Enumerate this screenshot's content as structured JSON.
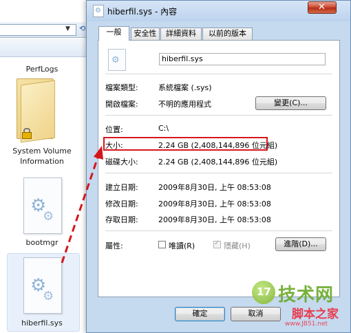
{
  "explorer": {
    "items": [
      {
        "label": "PerfLogs"
      },
      {
        "label": "System Volume Information"
      },
      {
        "label": "bootmgr"
      },
      {
        "label": "hiberfil.sys"
      }
    ]
  },
  "dialog": {
    "title": "hiberfil.sys - 內容",
    "close_label": "✕",
    "tabs": [
      {
        "label": "一般",
        "active": true
      },
      {
        "label": "安全性"
      },
      {
        "label": "詳細資料"
      },
      {
        "label": "以前的版本"
      }
    ],
    "general": {
      "filename": "hiberfil.sys",
      "type_label": "檔案類型:",
      "type_value": "系統檔案 (.sys)",
      "opens_label": "開啟檔案:",
      "opens_value": "不明的應用程式",
      "change_button": "變更(C)...",
      "location_label": "位置:",
      "location_value": "C:\\",
      "size_label": "大小:",
      "size_value": "2.24 GB (2,408,144,896 位元組)",
      "disk_size_label": "磁碟大小:",
      "disk_size_value": "2.24 GB (2,408,144,896 位元組)",
      "created_label": "建立日期:",
      "created_value": "2009年8月30日, 上午 08:53:08",
      "modified_label": "修改日期:",
      "modified_value": "2009年8月30日, 上午 08:53:08",
      "accessed_label": "存取日期:",
      "accessed_value": "2009年8月30日, 上午 08:53:08",
      "attributes_label": "屬性:",
      "readonly_label": "唯讀(R)",
      "readonly_checked": false,
      "hidden_label": "隱藏(H)",
      "hidden_checked": true,
      "advanced_button": "進階(D)..."
    },
    "footer": {
      "ok": "確定",
      "cancel": "取消"
    }
  },
  "watermark": {
    "badge": "17",
    "brand": "技术网",
    "sub": "脚本之家",
    "url": "www.JB51.net"
  },
  "colors": {
    "highlight": "#d4161b",
    "arrow": "#d4161b",
    "dialog_frame": "#c5d9ef"
  }
}
